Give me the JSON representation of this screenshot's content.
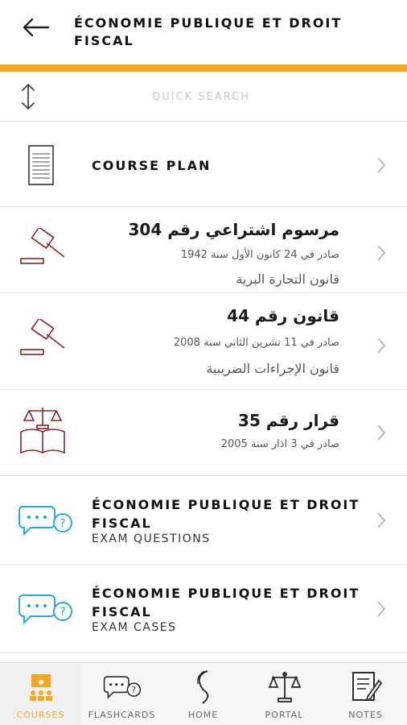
{
  "header": {
    "title": "ÉCONOMIE PUBLIQUE ET DROIT FISCAL"
  },
  "search": {
    "placeholder": "QUICK SEARCH",
    "value": ""
  },
  "course_plan": {
    "label": "COURSE PLAN"
  },
  "laws": [
    {
      "title": "مرسوم اشتراعي رقم 304",
      "date": "صادر في 24 كانون الأول سنة 1942",
      "category": "قانون التجارة البرية",
      "icon": "gavel-icon"
    },
    {
      "title": "قانون رقم 44",
      "date": "صادر في 11 تشرين الثاني سنة 2008",
      "category": "قانون الإجراءات الضريبية",
      "icon": "gavel-icon"
    },
    {
      "title": "قرار رقم 35",
      "date": "صادر في 3 اذار سنة 2005",
      "icon": "scales-book-icon"
    }
  ],
  "questions": [
    {
      "title": "ÉCONOMIE PUBLIQUE ET DROIT FISCAL",
      "subtitle": "EXAM QUESTIONS",
      "icon": "chat-question-icon"
    },
    {
      "title": "ÉCONOMIE PUBLIQUE ET DROIT FISCAL",
      "subtitle": "EXAM CASES",
      "icon": "chat-question-icon"
    }
  ],
  "tabs": [
    {
      "label": "COURSES",
      "icon": "courses-icon",
      "active": true
    },
    {
      "label": "FLASHCARDS",
      "icon": "flashcards-icon",
      "active": false
    },
    {
      "label": "HOME",
      "icon": "home-logo-icon",
      "active": false
    },
    {
      "label": "PORTAL",
      "icon": "scales-icon",
      "active": false
    },
    {
      "label": "NOTES",
      "icon": "notes-icon",
      "active": false
    }
  ],
  "colors": {
    "accent": "#f5a623",
    "law_icon": "#8b2323",
    "question_icon": "#29a8e0",
    "tab_icon": "#2b2b2b"
  }
}
